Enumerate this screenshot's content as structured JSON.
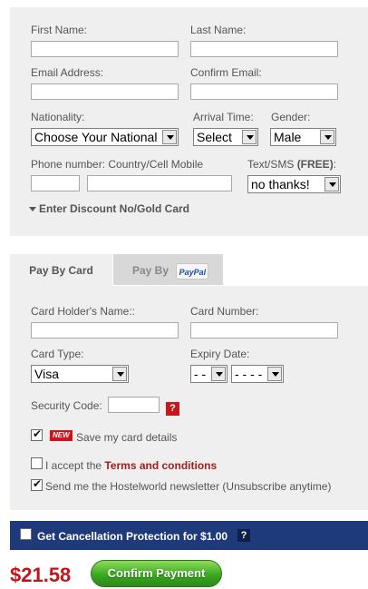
{
  "personal": {
    "first_name_label": "First Name:",
    "last_name_label": "Last Name:",
    "email_label": "Email Address:",
    "confirm_email_label": "Confirm Email:",
    "nationality_label": "Nationality:",
    "nationality_value": "Choose Your National",
    "arrival_label": "Arrival Time:",
    "arrival_value": "Select",
    "gender_label": "Gender:",
    "gender_value": "Male",
    "phone_label": "Phone number: Country/Cell Mobile",
    "sms_label_prefix": "Text/SMS ",
    "sms_label_free": "(FREE)",
    "sms_label_suffix": ":",
    "sms_value": "no thanks!",
    "discount_toggle": "Enter Discount No/Gold Card"
  },
  "payment_tabs": {
    "card_tab": "Pay By Card",
    "paypal_tab": "Pay By",
    "paypal_logo": "PayPal"
  },
  "card": {
    "holder_label": "Card Holder's Name::",
    "number_label": "Card Number:",
    "type_label": "Card Type:",
    "type_value": "Visa",
    "expiry_label": "Expiry Date:",
    "expiry_month": "- -",
    "expiry_year": "- - - -",
    "security_label": "Security Code:",
    "help_icon": "?",
    "new_badge": "NEW",
    "save_details_label": "Save my card details",
    "terms_prefix": "I accept the ",
    "terms_link": "Terms and conditions",
    "newsletter_label": "Send me the Hostelworld newsletter (Unsubscribe anytime)"
  },
  "protection": {
    "label": "Get Cancellation Protection for $1.00",
    "help_icon": "?"
  },
  "footer": {
    "price": "$21.58",
    "confirm_button": "Confirm Payment"
  },
  "colors": {
    "panel_bg": "#efefef",
    "price_red": "#c0161a",
    "terms_red": "#a61c1c",
    "protection_bar": "#1f3a7a",
    "confirm_green": "#39a520"
  }
}
